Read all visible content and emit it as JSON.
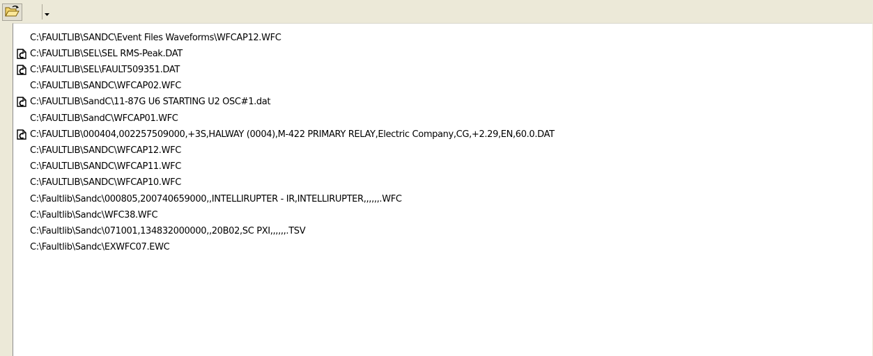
{
  "toolbar": {
    "open_icon": "open-folder-icon",
    "dropdown_icon": "dropdown-arrow-icon"
  },
  "recent_files": [
    {
      "path": "C:\\FAULTLIB\\SANDC\\Event Files  Waveforms\\WFCAP12.WFC",
      "icon": null
    },
    {
      "path": "C:\\FAULTLIB\\SEL\\SEL RMS-Peak.DAT",
      "icon": "comtrade-file-icon"
    },
    {
      "path": "C:\\FAULTLIB\\SEL\\FAULT509351.DAT",
      "icon": "comtrade-file-icon"
    },
    {
      "path": "C:\\FAULTLIB\\SANDC\\WFCAP02.WFC",
      "icon": null
    },
    {
      "path": "C:\\FAULTLIB\\SandC\\11-87G U6 STARTING U2 OSC#1.dat",
      "icon": "comtrade-file-icon"
    },
    {
      "path": "C:\\FAULTLIB\\SandC\\WFCAP01.WFC",
      "icon": null
    },
    {
      "path": "C:\\FAULTLIB\\000404,002257509000,+3S,HALWAY (0004),M-422 PRIMARY RELAY,Electric Company,CG,+2.29,EN,60.0.DAT",
      "icon": "comtrade-file-icon"
    },
    {
      "path": "C:\\FAULTLIB\\SANDC\\WFCAP12.WFC",
      "icon": null
    },
    {
      "path": "C:\\FAULTLIB\\SANDC\\WFCAP11.WFC",
      "icon": null
    },
    {
      "path": "C:\\FAULTLIB\\SANDC\\WFCAP10.WFC",
      "icon": null
    },
    {
      "path": "C:\\Faultlib\\Sandc\\000805,200740659000,,INTELLIRUPTER - IR,INTELLIRUPTER,,,,,,.WFC",
      "icon": null
    },
    {
      "path": "C:\\Faultlib\\Sandc\\WFC38.WFC",
      "icon": null
    },
    {
      "path": "C:\\Faultlib\\Sandc\\071001,134832000000,,20B02,SC PXI,,,,,,.TSV",
      "icon": null
    },
    {
      "path": "C:\\Faultlib\\Sandc\\EXWFC07.EWC",
      "icon": null
    }
  ]
}
